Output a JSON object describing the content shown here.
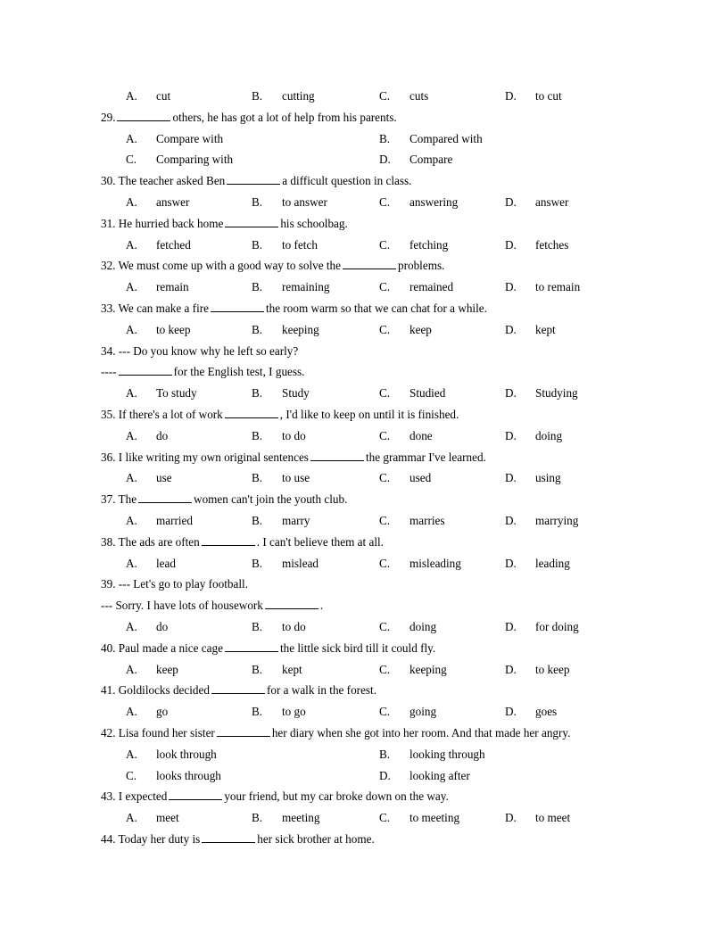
{
  "document": {
    "type": "english-grammar-multiple-choice-worksheet",
    "blank_marker": "________"
  },
  "continued_options": {
    "a_label": "A.",
    "a_text": "cut",
    "b_label": "B.",
    "b_text": "cutting",
    "c_label": "C.",
    "c_text": "cuts",
    "d_label": "D.",
    "d_text": "to cut"
  },
  "questions": [
    {
      "number": "29.",
      "stem_pre": "29.",
      "stem_post": "others, he has got a lot of help from his parents.",
      "layout": "two-column",
      "a_label": "A.",
      "a_text": "Compare with",
      "b_label": "B.",
      "b_text": "Compared with",
      "c_label": "C.",
      "c_text": "Comparing with",
      "d_label": "D.",
      "d_text": "Compare"
    },
    {
      "number": "30.",
      "stem_pre": "30. The teacher asked Ben",
      "stem_post": "a difficult question in class.",
      "layout": "four-column",
      "a_label": "A.",
      "a_text": "answer",
      "b_label": "B.",
      "b_text": "to answer",
      "c_label": "C.",
      "c_text": "answering",
      "d_label": "D.",
      "d_text": "answer"
    },
    {
      "number": "31.",
      "stem_pre": "31. He hurried back home",
      "stem_post": "his schoolbag.",
      "layout": "four-column",
      "a_label": "A.",
      "a_text": "fetched",
      "b_label": "B.",
      "b_text": "to fetch",
      "c_label": "C.",
      "c_text": "fetching",
      "d_label": "D.",
      "d_text": "fetches"
    },
    {
      "number": "32.",
      "stem_pre": "32. We must come up with a good way to solve the",
      "stem_post": "problems.",
      "layout": "four-column",
      "a_label": "A.",
      "a_text": "remain",
      "b_label": "B.",
      "b_text": "remaining",
      "c_label": "C.",
      "c_text": "remained",
      "d_label": "D.",
      "d_text": "to remain"
    },
    {
      "number": "33.",
      "stem_pre": "33. We can make a fire",
      "stem_post": "the room warm so that we can chat for a while.",
      "layout": "four-column",
      "a_label": "A.",
      "a_text": "to keep",
      "b_label": "B.",
      "b_text": "keeping",
      "c_label": "C.",
      "c_text": "keep",
      "d_label": "D.",
      "d_text": "kept"
    },
    {
      "number": "34.",
      "stem_line": "34. --- Do you know why he left so early?",
      "reply_pre": "----",
      "reply_post": "for the English test, I guess.",
      "layout": "four-column",
      "a_label": "A.",
      "a_text": "To study",
      "b_label": "B.",
      "b_text": "Study",
      "c_label": "C.",
      "c_text": "Studied",
      "d_label": "D.",
      "d_text": "Studying"
    },
    {
      "number": "35.",
      "stem_pre": "35. If there's a lot of work",
      "stem_post": ", I'd like to keep on until it is finished.",
      "layout": "four-column",
      "a_label": "A.",
      "a_text": "do",
      "b_label": "B.",
      "b_text": "to do",
      "c_label": "C.",
      "c_text": "done",
      "d_label": "D.",
      "d_text": "doing"
    },
    {
      "number": "36.",
      "stem_pre": "36. I like writing my own original sentences",
      "stem_post": "the grammar I've learned.",
      "layout": "four-column",
      "a_label": "A.",
      "a_text": "use",
      "b_label": "B.",
      "b_text": "to use",
      "c_label": "C.",
      "c_text": "used",
      "d_label": "D.",
      "d_text": "using"
    },
    {
      "number": "37.",
      "stem_pre": "37. The",
      "stem_post": "women can't join the youth club.",
      "layout": "four-column",
      "a_label": "A.",
      "a_text": "married",
      "b_label": "B.",
      "b_text": "marry",
      "c_label": "C.",
      "c_text": "marries",
      "d_label": "D.",
      "d_text": "marrying"
    },
    {
      "number": "38.",
      "stem_pre": "38. The ads are often",
      "stem_post": ". I can't believe them at all.",
      "layout": "four-column",
      "a_label": "A.",
      "a_text": "lead",
      "b_label": "B.",
      "b_text": "mislead",
      "c_label": "C.",
      "c_text": "misleading",
      "d_label": "D.",
      "d_text": "leading"
    },
    {
      "number": "39.",
      "stem_line": "39. --- Let's go to play football.",
      "reply_pre": "--- Sorry. I have lots of housework",
      "reply_post": ".",
      "layout": "four-column",
      "a_label": "A.",
      "a_text": "do",
      "b_label": "B.",
      "b_text": "to do",
      "c_label": "C.",
      "c_text": "doing",
      "d_label": "D.",
      "d_text": "for doing"
    },
    {
      "number": "40.",
      "stem_pre": "40. Paul made a nice cage",
      "stem_post": "the little sick bird till it could fly.",
      "layout": "four-column",
      "a_label": "A.",
      "a_text": "keep",
      "b_label": "B.",
      "b_text": "kept",
      "c_label": "C.",
      "c_text": "keeping",
      "d_label": "D.",
      "d_text": "to keep"
    },
    {
      "number": "41.",
      "stem_pre": "41. Goldilocks decided",
      "stem_post": "for a walk in the forest.",
      "layout": "four-column",
      "a_label": "A.",
      "a_text": "go",
      "b_label": "B.",
      "b_text": "to go",
      "c_label": "C.",
      "c_text": "going",
      "d_label": "D.",
      "d_text": "goes"
    },
    {
      "number": "42.",
      "stem_pre": "42. Lisa found her sister",
      "stem_post": "her diary when she got into her room. And that made her angry.",
      "layout": "two-column",
      "a_label": "A.",
      "a_text": "look through",
      "b_label": "B.",
      "b_text": "looking through",
      "c_label": "C.",
      "c_text": "looks through",
      "d_label": "D.",
      "d_text": "looking after"
    },
    {
      "number": "43.",
      "stem_pre": "43. I expected",
      "stem_post": "your friend, but my car broke down on the way.",
      "layout": "four-column",
      "a_label": "A.",
      "a_text": "meet",
      "b_label": "B.",
      "b_text": "meeting",
      "c_label": "C.",
      "c_text": "to meeting",
      "d_label": "D.",
      "d_text": "to meet"
    },
    {
      "number": "44.",
      "stem_pre": "44. Today her duty is",
      "stem_post": "her sick brother at home.",
      "layout": "none"
    }
  ]
}
